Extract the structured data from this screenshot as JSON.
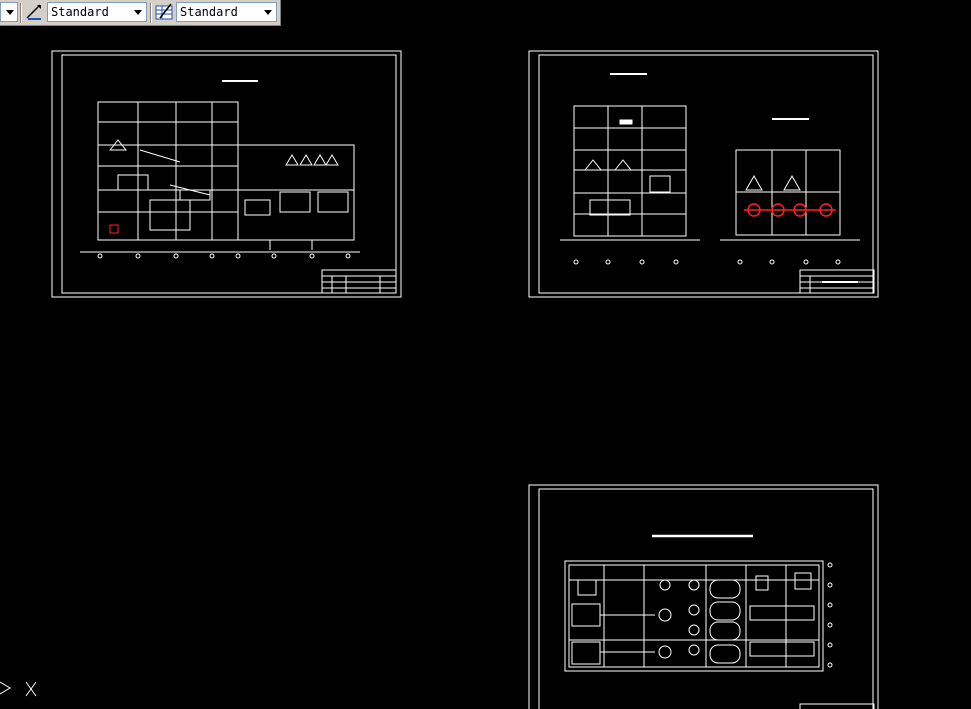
{
  "toolbar": {
    "dimstyle_label": "Standard",
    "tablestyle_label": "Standard"
  },
  "colors": {
    "background": "#000000",
    "drawing_lines": "#ffffff",
    "highlight": "#ff2020",
    "toolbar_bg": "#d4d0c8"
  },
  "icons": [
    "dimension-style-icon",
    "table-style-icon",
    "dropdown-arrow-icon",
    "ucs-axis-icon"
  ]
}
